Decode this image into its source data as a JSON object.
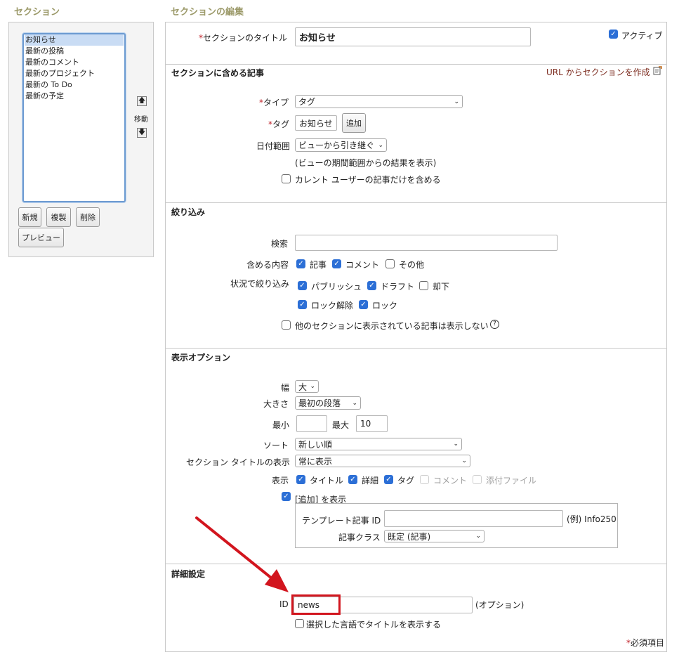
{
  "left": {
    "heading": "セクション",
    "items": [
      "お知らせ",
      "最新の投稿",
      "最新のコメント",
      "最新のプロジェクト",
      "最新の To Do",
      "最新の予定"
    ],
    "move_label": "移動",
    "up_glyph": "🡅",
    "down_glyph": "🡇",
    "buttons": {
      "new": "新規",
      "duplicate": "複製",
      "delete": "削除",
      "preview": "プレビュー"
    }
  },
  "editor": {
    "heading": "セクションの編集",
    "required_mark": "*",
    "title_label": "セクションのタイトル",
    "title_value": "お知らせ",
    "active_label": "アクティブ",
    "articles": {
      "title": "セクションに含める記事",
      "url_link": "URL からセクションを作成",
      "type_label": "タイプ",
      "type_value": "タグ",
      "tag_label": "タグ",
      "tag_value": "お知らせ",
      "add_button": "追加",
      "date_label": "日付範囲",
      "date_value": "ビューから引き継ぐ",
      "date_note": "(ビューの期間範囲からの結果を表示)",
      "current_user_label": "カレント ユーザーの記事だけを含める"
    },
    "filter": {
      "title": "絞り込み",
      "search_label": "検索",
      "include_label": "含める内容",
      "include_articles": "記事",
      "include_comments": "コメント",
      "include_other": "その他",
      "status_label": "状況で絞り込み",
      "status_publish": "パブリッシュ",
      "status_draft": "ドラフト",
      "status_rejected": "却下",
      "status_unlocked": "ロック解除",
      "status_locked": "ロック",
      "hide_other_label": "他のセクションに表示されている記事は表示しない",
      "help_glyph": "?"
    },
    "display": {
      "title": "表示オプション",
      "width_label": "幅",
      "width_value": "大",
      "size_label": "大きさ",
      "size_value": "最初の段落",
      "min_label": "最小",
      "min_value": "",
      "max_label": "最大",
      "max_value": "10",
      "sort_label": "ソート",
      "sort_value": "新しい順",
      "section_title_label": "セクション タイトルの表示",
      "section_title_value": "常に表示",
      "show_label": "表示",
      "show_title": "タイトル",
      "show_details": "詳細",
      "show_tags": "タグ",
      "show_comments": "コメント",
      "show_attachments": "添付ファイル",
      "add_show_label": "[追加] を表示",
      "template_label": "テンプレート記事 ID",
      "template_value": "",
      "template_example": "(例) Info250",
      "class_label": "記事クラス",
      "class_value": "既定 (記事)"
    },
    "advanced": {
      "title": "詳細設定",
      "id_label": "ID",
      "id_value": "news",
      "id_optional": "(オプション)",
      "lang_title_label": "選択した言語でタイトルを表示する"
    },
    "required_note": "必須項目"
  },
  "colors": {
    "heading": "#9c9a6a",
    "required": "#c0242b",
    "checkbox": "#2c6fd6",
    "callout": "#d2151e"
  }
}
